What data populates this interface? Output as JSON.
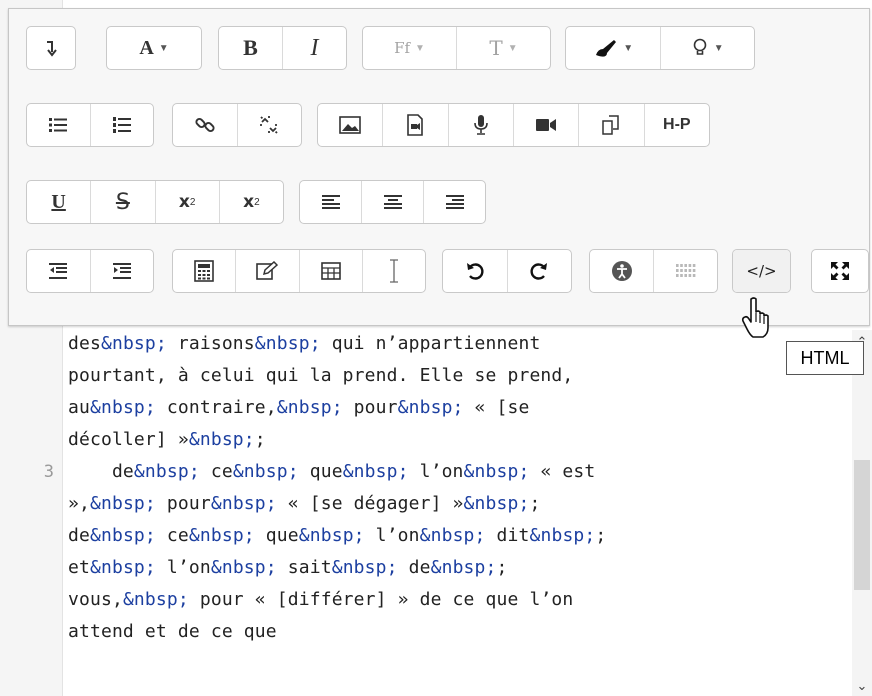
{
  "editor": {
    "lines": [
      {
        "number": "",
        "segments": [
          [
            "des",
            ""
          ],
          [
            "&nbsp;",
            "ent"
          ],
          [
            " raisons",
            ""
          ],
          [
            "&nbsp;",
            "ent"
          ],
          [
            " qui n’appartiennent ",
            ""
          ]
        ]
      },
      {
        "number": "",
        "segments": [
          [
            "pourtant, à celui qui la prend. Elle se prend,",
            ""
          ]
        ]
      },
      {
        "number": "",
        "segments": [
          [
            "au",
            ""
          ],
          [
            "&nbsp;",
            "ent"
          ],
          [
            " contraire,",
            ""
          ],
          [
            "&nbsp;",
            "ent"
          ],
          [
            " pour",
            ""
          ],
          [
            "&nbsp;",
            "ent"
          ],
          [
            " « [se",
            ""
          ]
        ]
      },
      {
        "number": "",
        "segments": [
          [
            "décoller] »",
            ""
          ],
          [
            "&nbsp;",
            "ent"
          ],
          [
            ";",
            ""
          ]
        ]
      },
      {
        "number": "3",
        "segments": [
          [
            "    de",
            ""
          ],
          [
            "&nbsp;",
            "ent"
          ],
          [
            " ce",
            ""
          ],
          [
            "&nbsp;",
            "ent"
          ],
          [
            " que",
            ""
          ],
          [
            "&nbsp;",
            "ent"
          ],
          [
            " l’on",
            ""
          ],
          [
            "&nbsp;",
            "ent"
          ],
          [
            " « est",
            ""
          ]
        ]
      },
      {
        "number": "",
        "segments": [
          [
            "»,",
            ""
          ],
          [
            "&nbsp;",
            "ent"
          ],
          [
            " pour",
            ""
          ],
          [
            "&nbsp;",
            "ent"
          ],
          [
            " « [se dégager] »",
            ""
          ],
          [
            "&nbsp;",
            "ent"
          ],
          [
            ";",
            ""
          ]
        ]
      },
      {
        "number": "",
        "segments": [
          [
            "de",
            ""
          ],
          [
            "&nbsp;",
            "ent"
          ],
          [
            " ce",
            ""
          ],
          [
            "&nbsp;",
            "ent"
          ],
          [
            " que",
            ""
          ],
          [
            "&nbsp;",
            "ent"
          ],
          [
            " l’on",
            ""
          ],
          [
            "&nbsp;",
            "ent"
          ],
          [
            " dit",
            ""
          ],
          [
            "&nbsp;",
            "ent"
          ],
          [
            ";",
            ""
          ]
        ]
      },
      {
        "number": "",
        "segments": [
          [
            "et",
            ""
          ],
          [
            "&nbsp;",
            "ent"
          ],
          [
            " l’on",
            ""
          ],
          [
            "&nbsp;",
            "ent"
          ],
          [
            " sait",
            ""
          ],
          [
            "&nbsp;",
            "ent"
          ],
          [
            " de",
            ""
          ],
          [
            "&nbsp;",
            "ent"
          ],
          [
            ";",
            ""
          ]
        ]
      },
      {
        "number": "",
        "segments": [
          [
            "vous,",
            ""
          ],
          [
            "&nbsp;",
            "ent"
          ],
          [
            " pour « [différer] » de ce que l’on",
            ""
          ]
        ]
      },
      {
        "number": "",
        "segments": [
          [
            "attend et de ce que",
            ""
          ]
        ]
      }
    ],
    "scroll_up_glyph": "⌃",
    "scroll_down_glyph": "⌄"
  },
  "toolbar": {
    "rows": [
      [
        {
          "name": "collapse-toolbar-group",
          "buttons": [
            {
              "name": "collapse-toolbar-button",
              "icon": "collapse-arrow-icon",
              "label": "↴"
            }
          ]
        },
        {
          "name": "font-color-group",
          "buttons": [
            {
              "name": "font-color-button",
              "icon": "font-color-icon",
              "label": "A",
              "caret": "▼"
            }
          ]
        },
        {
          "name": "bold-italic-group",
          "buttons": [
            {
              "name": "bold-button",
              "icon": "bold-icon",
              "label": "B"
            },
            {
              "name": "italic-button",
              "icon": "italic-icon",
              "label": "I"
            }
          ]
        },
        {
          "name": "font-group",
          "buttons": [
            {
              "name": "font-family-button",
              "icon": "font-family-icon",
              "label": "Ff",
              "caret": "▼",
              "dim": true
            },
            {
              "name": "font-size-button",
              "icon": "font-size-icon",
              "label": "T",
              "caret": "▼",
              "dim": true
            }
          ]
        },
        {
          "name": "color-group",
          "buttons": [
            {
              "name": "brush-color-button",
              "icon": "paint-brush-icon",
              "caret": "▼"
            },
            {
              "name": "highlight-button",
              "icon": "lightbulb-icon",
              "caret": "▼"
            }
          ]
        }
      ],
      [
        {
          "name": "list-group",
          "buttons": [
            {
              "name": "bullet-list-button",
              "icon": "bullet-list-icon"
            },
            {
              "name": "numbered-list-button",
              "icon": "numbered-list-icon"
            }
          ]
        },
        {
          "name": "link-group",
          "buttons": [
            {
              "name": "link-button",
              "icon": "link-icon"
            },
            {
              "name": "unlink-button",
              "icon": "unlink-icon"
            }
          ]
        },
        {
          "name": "media-group",
          "buttons": [
            {
              "name": "image-button",
              "icon": "image-icon"
            },
            {
              "name": "media-button",
              "icon": "media-file-icon"
            },
            {
              "name": "record-audio-button",
              "icon": "microphone-icon"
            },
            {
              "name": "record-video-button",
              "icon": "video-camera-icon"
            },
            {
              "name": "manage-files-button",
              "icon": "files-icon"
            },
            {
              "name": "h5p-button",
              "icon": "h5p-icon",
              "label": "H-P"
            }
          ]
        }
      ],
      [
        {
          "name": "format-group",
          "buttons": [
            {
              "name": "underline-button",
              "icon": "underline-icon",
              "label": "U"
            },
            {
              "name": "strikethrough-button",
              "icon": "strikethrough-icon",
              "label": "S"
            },
            {
              "name": "subscript-button",
              "icon": "subscript-icon",
              "label": "x",
              "sub": "2"
            },
            {
              "name": "superscript-button",
              "icon": "superscript-icon",
              "label": "x",
              "sup": "2"
            }
          ]
        },
        {
          "name": "align-group",
          "buttons": [
            {
              "name": "align-left-button",
              "icon": "align-left-icon"
            },
            {
              "name": "align-center-button",
              "icon": "align-center-icon"
            },
            {
              "name": "align-right-button",
              "icon": "align-right-icon"
            }
          ]
        }
      ],
      [
        {
          "name": "indent-group",
          "buttons": [
            {
              "name": "outdent-button",
              "icon": "outdent-icon"
            },
            {
              "name": "indent-button",
              "icon": "indent-icon"
            }
          ]
        },
        {
          "name": "insert-group",
          "buttons": [
            {
              "name": "equation-button",
              "icon": "calculator-icon"
            },
            {
              "name": "edit-button",
              "icon": "edit-icon"
            },
            {
              "name": "table-button",
              "icon": "table-icon"
            },
            {
              "name": "text-cursor-button",
              "icon": "text-cursor-icon"
            }
          ]
        },
        {
          "name": "history-group",
          "buttons": [
            {
              "name": "undo-button",
              "icon": "undo-icon"
            },
            {
              "name": "redo-button",
              "icon": "redo-icon"
            }
          ]
        },
        {
          "name": "accessibility-group",
          "buttons": [
            {
              "name": "accessibility-checker-button",
              "icon": "accessibility-icon"
            },
            {
              "name": "screenreader-helper-button",
              "icon": "grid-dots-icon",
              "dim": true
            }
          ]
        },
        {
          "name": "html-group",
          "buttons": [
            {
              "name": "html-button",
              "icon": "code-icon",
              "label": "</>",
              "active": true
            }
          ]
        },
        {
          "name": "fullscreen-group",
          "buttons": [
            {
              "name": "fullscreen-button",
              "icon": "fullscreen-icon"
            }
          ]
        }
      ]
    ]
  },
  "tooltip": {
    "text": "HTML"
  },
  "colors": {
    "entity": "#1c3fa0",
    "text": "#222222",
    "toolbar_bg": "#f7f7f7",
    "button_border": "#c9c9c9"
  }
}
